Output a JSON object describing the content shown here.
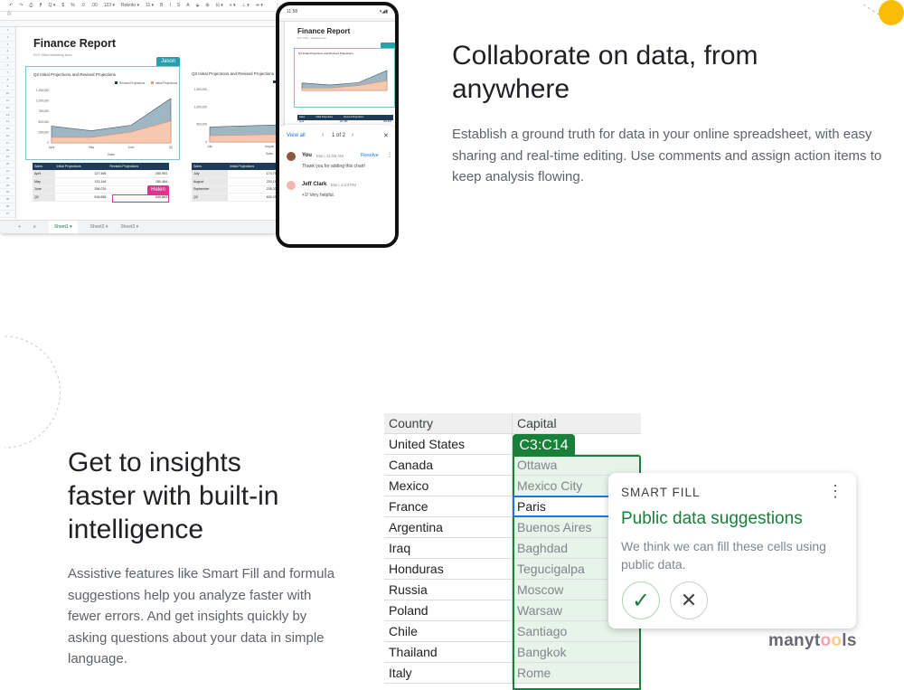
{
  "sheet": {
    "toolbar": [
      "↶",
      "↷",
      "⎙",
      "⁋",
      "Q ▾",
      "$",
      "%",
      ".0",
      ".00",
      "123 ▾",
      "Roboto ▾",
      "11 ▾",
      "B",
      "I",
      "S",
      "A",
      "⬙",
      "⊞",
      "⊟ ▾",
      "≡ ▾",
      "⊥ ▾",
      "⇹ ▾"
    ],
    "fx": "fx",
    "title": "Finance Report",
    "subtitle": "NYC Office    Marketing team",
    "jason": "Jason",
    "helen": "Helen",
    "q2": {
      "title": "Q2 Initial Projections and Revised Projections",
      "legend": [
        "Revised Projections",
        "Initial Projections"
      ],
      "xlabel": "Sales",
      "x": [
        "April",
        "May",
        "June",
        "Q2"
      ],
      "yticks": [
        "1,250,000",
        "1,000,000",
        "750,000",
        "500,000",
        "250,000",
        "0"
      ],
      "ymax": 1250000,
      "revised": [
        400000,
        290000,
        420000,
        1060000
      ],
      "initial": [
        130000,
        130000,
        260000,
        520000
      ]
    },
    "q3": {
      "title": "Q3 Initial Projections and Revised Projections",
      "legend": [
        "Revised Projections"
      ],
      "xlabel": "Sales",
      "x": [
        "July",
        "August"
      ],
      "yticks": [
        "1,500,000",
        "1,000,000",
        "500,000",
        "0"
      ],
      "ymax": 1500000,
      "revised": [
        430000,
        480000,
        460000
      ],
      "initial": [
        180000,
        210000,
        220000
      ]
    },
    "table_q2": {
      "headers": [
        "Sales",
        "Initial Projections",
        "Revised Projections"
      ],
      "rows": [
        [
          "April",
          "127,496",
          "250,993"
        ],
        [
          "May",
          "133,146",
          "150,464"
        ],
        [
          "June",
          "256,076",
          ""
        ],
        [
          "Q2",
          "516,658",
          "549,863"
        ]
      ]
    },
    "table_q3": {
      "headers": [
        "Sales",
        "Initial Projections",
        "R"
      ],
      "rows": [
        [
          "July",
          "174,753",
          ""
        ],
        [
          "August",
          "220,199",
          ""
        ],
        [
          "September",
          "235,338",
          ""
        ],
        [
          "Q3",
          "630,290",
          ""
        ]
      ]
    },
    "tabs": [
      "+",
      "≡",
      "Sheet1 ▾",
      "Sheet2 ▾",
      "Sheet3 ▾"
    ]
  },
  "phone": {
    "time": "11:58",
    "status": "▾◢▮",
    "title": "Finance Report",
    "subtitle": "NYC Office · Marketing team",
    "chart_title": "Q2 Initial Projections and Revised Projections",
    "table_headers": [
      "Sales",
      "Initial Projections",
      "Revised Projections"
    ],
    "table_row": [
      "April",
      "127,496",
      "250,993"
    ],
    "view_all": "View all",
    "pager": "1 of 2",
    "comments": [
      {
        "author": "You",
        "time": "Mon, 11:55 AM",
        "text": "Thank you for adding this chart!",
        "action": "Resolve"
      },
      {
        "author": "Jeff Clark",
        "time": "Mon, 1:23 PM",
        "text": "+1! Very helpful."
      }
    ]
  },
  "section1": {
    "heading": "Collaborate on data, from anywhere",
    "body": "Establish a ground truth for data in your online spreadsheet, with easy sharing and real-time editing. Use comments and assign action items to keep analysis flowing."
  },
  "section2": {
    "heading": "Get to insights faster with built-in intelligence",
    "body": "Assistive features like Smart Fill and formula suggestions help you analyze faster with fewer errors. And get insights quickly by asking questions about your data in simple language."
  },
  "capitals": {
    "headers": [
      "Country",
      "Capital"
    ],
    "range": "C3:C14",
    "rows": [
      [
        "United States",
        ""
      ],
      [
        "Canada",
        "Ottawa"
      ],
      [
        "Mexico",
        "Mexico City"
      ],
      [
        "France",
        "Paris"
      ],
      [
        "Argentina",
        "Buenos Aires"
      ],
      [
        "Iraq",
        "Baghdad"
      ],
      [
        "Honduras",
        "Tegucigalpa"
      ],
      [
        "Russia",
        "Moscow"
      ],
      [
        "Poland",
        "Warsaw"
      ],
      [
        "Chile",
        "Santiago"
      ],
      [
        "Thailand",
        "Bangkok"
      ],
      [
        "Italy",
        "Rome"
      ]
    ]
  },
  "smart_fill": {
    "label": "SMART FILL",
    "title": "Public data suggestions",
    "body": "We think we can fill these cells using public data.",
    "accept_icon": "check-icon",
    "reject_icon": "close-icon"
  },
  "logo": "manytools",
  "colors": {
    "green": "#188038",
    "fill_green": "#e6f4ea",
    "blue": "#1a73e8",
    "teal": "#26a0b0",
    "pink": "#e0338f",
    "navy": "#1f3b57",
    "sun": "#fbbc04",
    "revised": "#9fb6c3",
    "initial": "#f6c8b0"
  }
}
